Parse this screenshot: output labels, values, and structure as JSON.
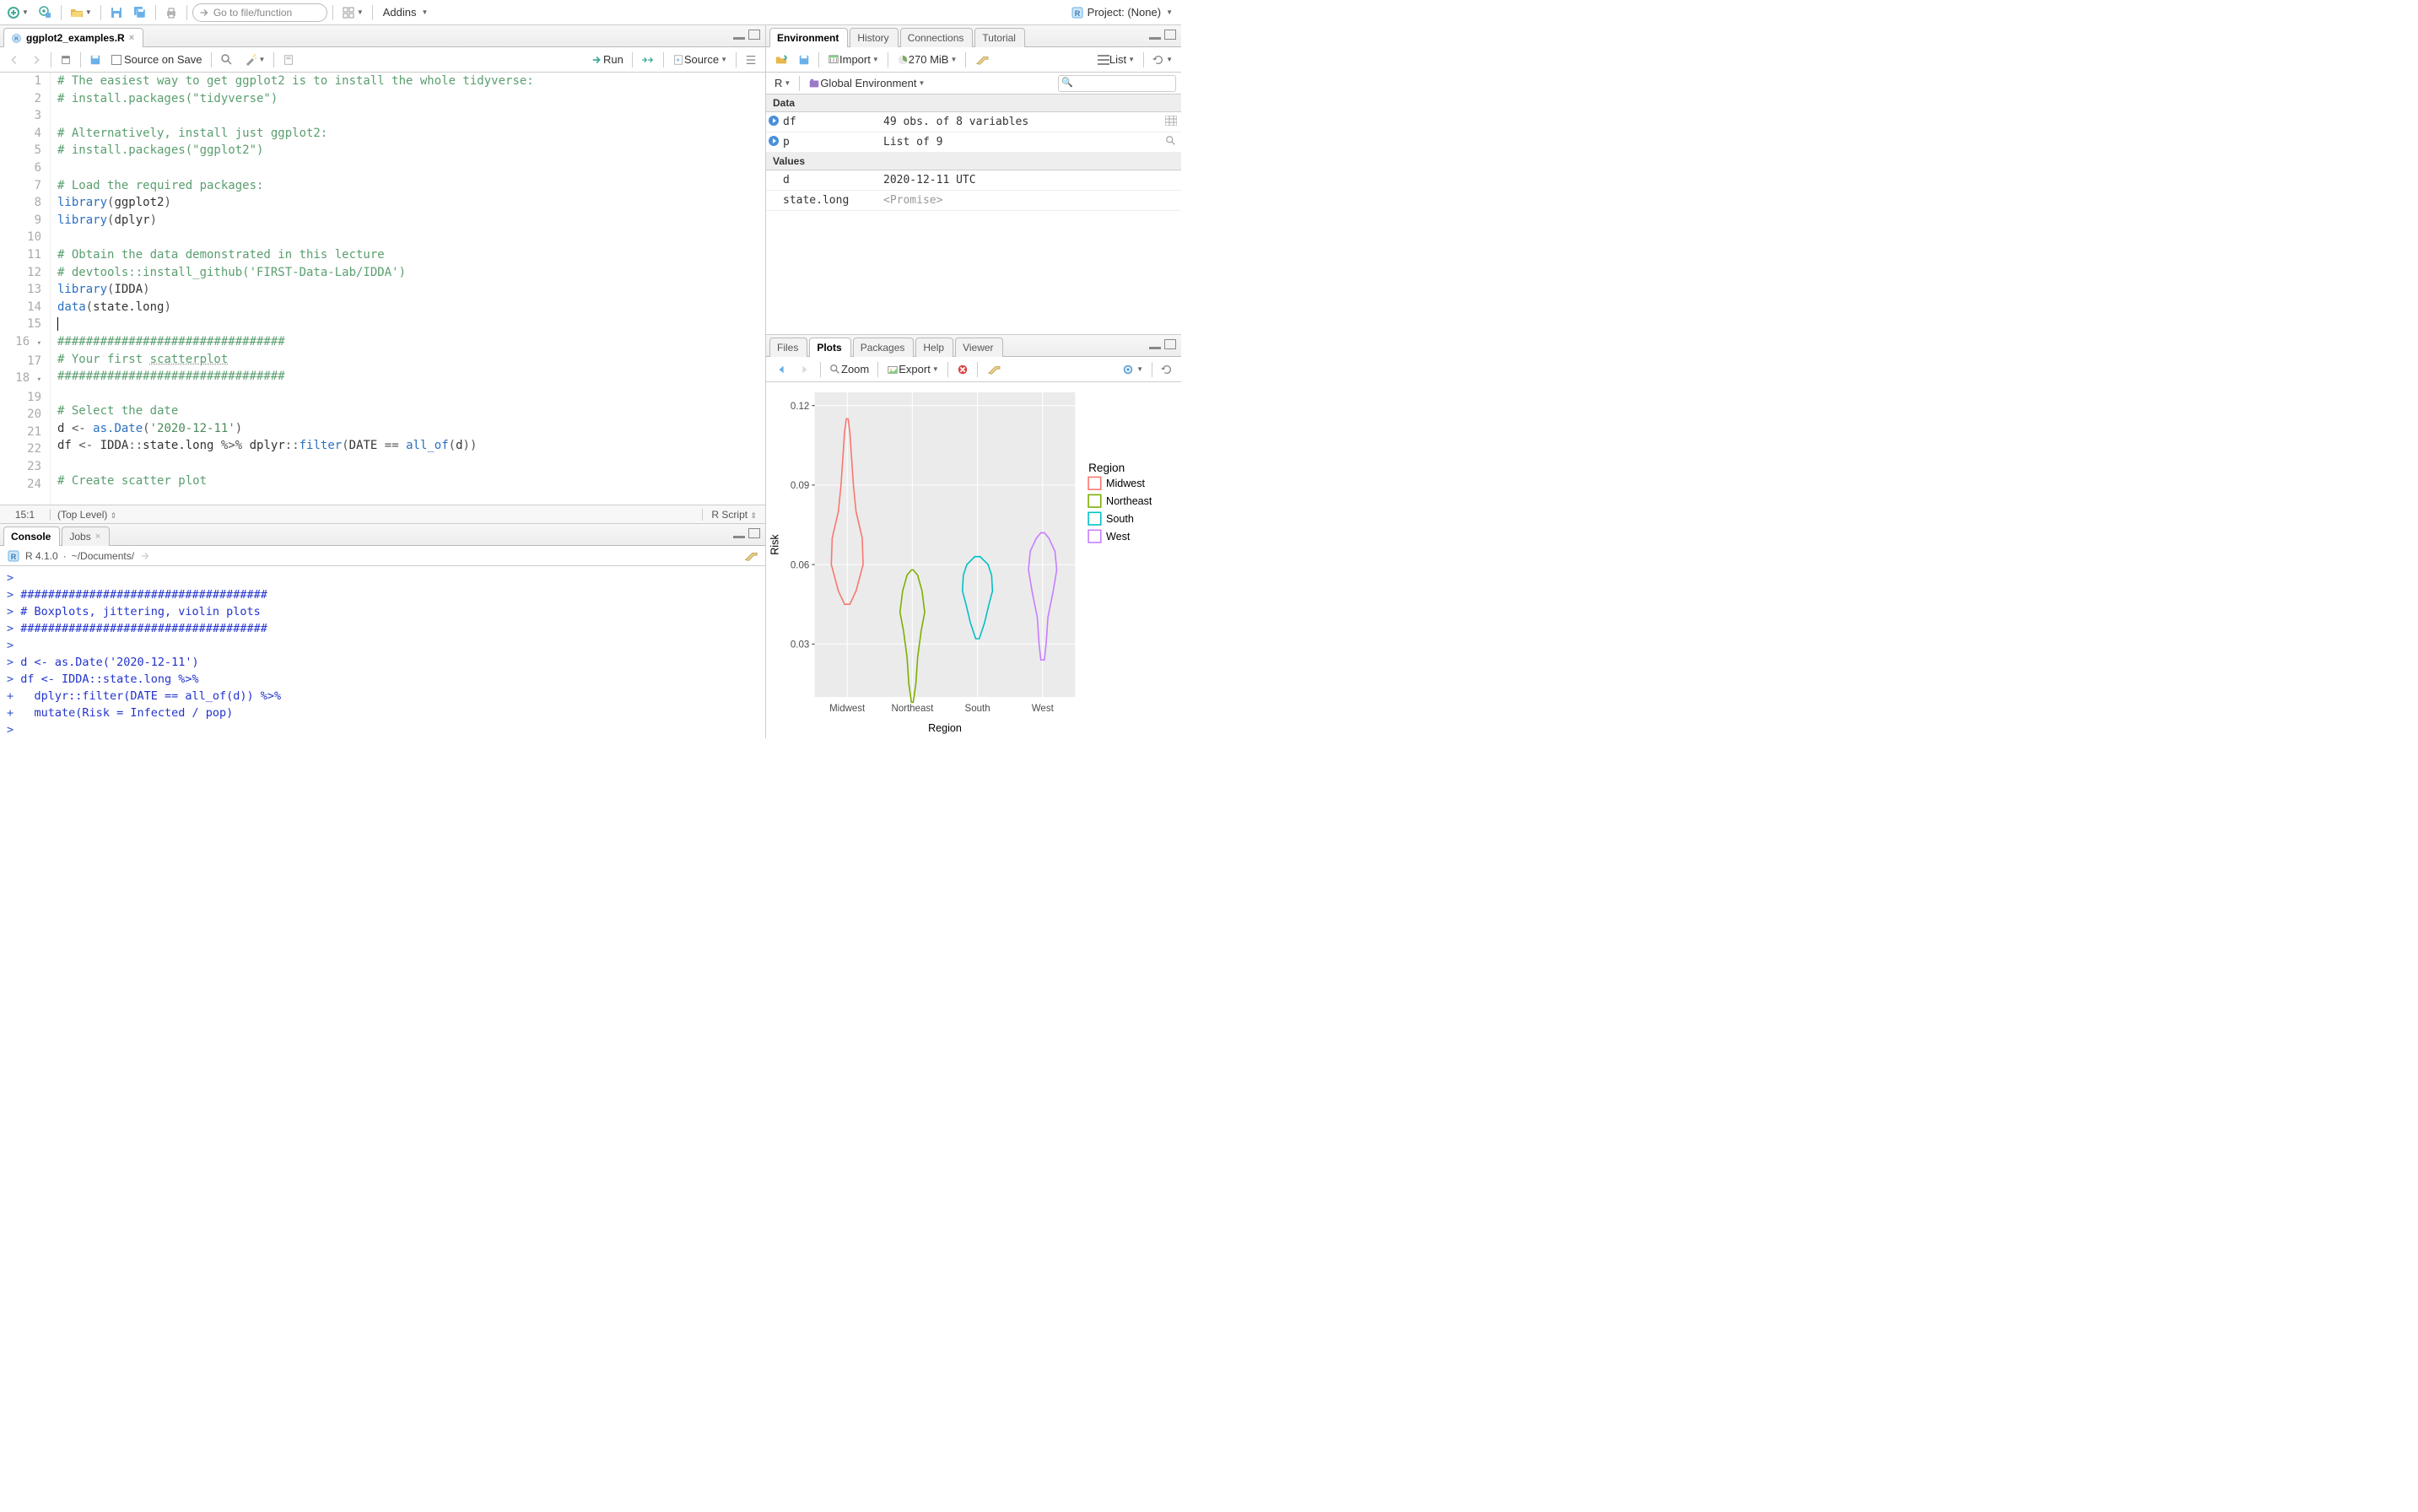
{
  "top": {
    "goto_placeholder": "Go to file/function",
    "addins": "Addins",
    "project_label": "Project: (None)"
  },
  "source": {
    "filename": "ggplot2_examples.R",
    "save_on_source": "Source on Save",
    "run": "Run",
    "source_btn": "Source",
    "status_pos": "15:1",
    "status_scope": "(Top Level)",
    "status_lang": "R Script",
    "lines": [
      {
        "n": 1,
        "type": "comment",
        "text": "# The easiest way to get ggplot2 is to install the whole tidyverse:"
      },
      {
        "n": 2,
        "type": "comment",
        "text": "# install.packages(\"tidyverse\")"
      },
      {
        "n": 3,
        "type": "blank",
        "text": ""
      },
      {
        "n": 4,
        "type": "comment",
        "text": "# Alternatively, install just ggplot2:"
      },
      {
        "n": 5,
        "type": "comment",
        "text": "# install.packages(\"ggplot2\")"
      },
      {
        "n": 6,
        "type": "blank",
        "text": ""
      },
      {
        "n": 7,
        "type": "comment",
        "text": "# Load the required packages:"
      },
      {
        "n": 8,
        "type": "code",
        "html": "<span class='s-func'>library</span><span class='s-paren'>(</span>ggplot2<span class='s-paren'>)</span>"
      },
      {
        "n": 9,
        "type": "code",
        "html": "<span class='s-func'>library</span><span class='s-paren'>(</span>dplyr<span class='s-paren'>)</span>"
      },
      {
        "n": 10,
        "type": "blank",
        "text": ""
      },
      {
        "n": 11,
        "type": "comment",
        "text": "# Obtain the data demonstrated in this lecture"
      },
      {
        "n": 12,
        "type": "comment",
        "text": "# devtools::install_github('FIRST-Data-Lab/IDDA')"
      },
      {
        "n": 13,
        "type": "code",
        "html": "<span class='s-func'>library</span><span class='s-paren'>(</span>IDDA<span class='s-paren'>)</span>"
      },
      {
        "n": 14,
        "type": "code",
        "html": "<span class='s-func'>data</span><span class='s-paren'>(</span>state.long<span class='s-paren'>)</span>"
      },
      {
        "n": 15,
        "type": "cursor",
        "text": ""
      },
      {
        "n": 16,
        "type": "comment-fold",
        "text": "################################"
      },
      {
        "n": 17,
        "type": "comment-scatter",
        "prefix": "# Your first ",
        "word": "scatterplot"
      },
      {
        "n": 18,
        "type": "comment-fold",
        "text": "################################"
      },
      {
        "n": 19,
        "type": "blank",
        "text": ""
      },
      {
        "n": 20,
        "type": "comment",
        "text": "# Select the date"
      },
      {
        "n": 21,
        "type": "code",
        "html": "d <span class='s-op'>&lt;-</span> <span class='s-func'>as.Date</span><span class='s-paren'>(</span><span class='s-str'>'2020-12-11'</span><span class='s-paren'>)</span>"
      },
      {
        "n": 22,
        "type": "code",
        "html": "df <span class='s-op'>&lt;-</span> IDDA<span class='s-op'>::</span>state.long <span class='s-op'>%&gt;%</span> dplyr<span class='s-op'>::</span><span class='s-func'>filter</span><span class='s-paren'>(</span>DATE <span class='s-op'>==</span> <span class='s-func'>all_of</span><span class='s-paren'>(</span>d<span class='s-paren'>))</span>"
      },
      {
        "n": 23,
        "type": "blank",
        "text": ""
      },
      {
        "n": 24,
        "type": "comment",
        "text": "# Create scatter plot"
      }
    ]
  },
  "console": {
    "tab_console": "Console",
    "tab_jobs": "Jobs",
    "version": "R 4.1.0",
    "wd": "~/Documents/",
    "lines": [
      {
        "p": ">",
        "t": ""
      },
      {
        "p": ">",
        "t": "####################################"
      },
      {
        "p": ">",
        "t": "# Boxplots, jittering, violin plots"
      },
      {
        "p": ">",
        "t": "####################################"
      },
      {
        "p": ">",
        "t": ""
      },
      {
        "p": ">",
        "t": "d <- as.Date('2020-12-11')"
      },
      {
        "p": ">",
        "t": "df <- IDDA::state.long %>%"
      },
      {
        "p": "+",
        "t": "  dplyr::filter(DATE == all_of(d)) %>%"
      },
      {
        "p": "+",
        "t": "  mutate(Risk = Infected / pop)"
      },
      {
        "p": ">",
        "t": ""
      }
    ]
  },
  "env": {
    "tabs": [
      "Environment",
      "History",
      "Connections",
      "Tutorial"
    ],
    "import": "Import",
    "mem": "270 MiB",
    "view": "List",
    "scope_r": "R",
    "scope_env": "Global Environment",
    "sections": {
      "data": "Data",
      "values": "Values"
    },
    "data_rows": [
      {
        "name": "df",
        "val": "49 obs. of 8 variables",
        "icon": "grid",
        "play": true
      },
      {
        "name": "p",
        "val": "List of  9",
        "icon": "search",
        "play": true
      }
    ],
    "value_rows": [
      {
        "name": "d",
        "val": "2020-12-11 UTC"
      },
      {
        "name": "state.long",
        "val": "<Promise>",
        "grey": true
      }
    ]
  },
  "plots": {
    "tabs": [
      "Files",
      "Plots",
      "Packages",
      "Help",
      "Viewer"
    ],
    "zoom": "Zoom",
    "export": "Export"
  },
  "chart_data": {
    "type": "violin",
    "title": "",
    "xlabel": "Region",
    "ylabel": "Risk",
    "categories": [
      "Midwest",
      "Northeast",
      "South",
      "West"
    ],
    "series": [
      {
        "name": "Midwest",
        "color": "#F8766D",
        "range": [
          0.045,
          0.115
        ],
        "median": 0.065
      },
      {
        "name": "Northeast",
        "color": "#7CAE00",
        "range": [
          0.008,
          0.058
        ],
        "median": 0.042
      },
      {
        "name": "South",
        "color": "#00BFC4",
        "range": [
          0.032,
          0.063
        ],
        "median": 0.05
      },
      {
        "name": "West",
        "color": "#C77CFF",
        "range": [
          0.024,
          0.072
        ],
        "median": 0.055
      }
    ],
    "ylim": [
      0.01,
      0.125
    ],
    "yticks": [
      0.03,
      0.06,
      0.09,
      0.12
    ],
    "legend_title": "Region",
    "legend": [
      "Midwest",
      "Northeast",
      "South",
      "West"
    ],
    "legend_colors": [
      "#F8766D",
      "#7CAE00",
      "#00BFC4",
      "#C77CFF"
    ]
  }
}
